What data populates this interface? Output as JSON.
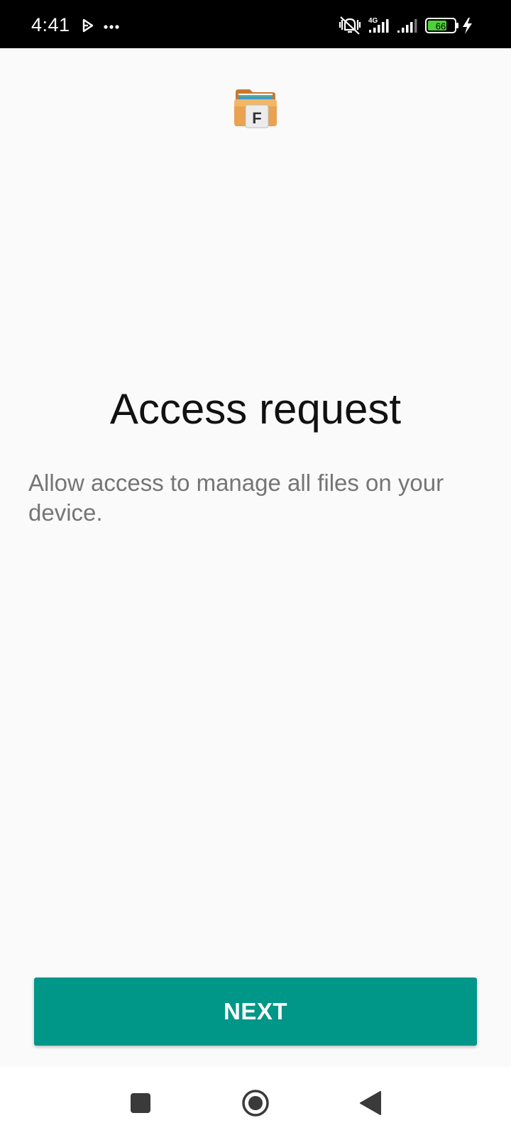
{
  "status_bar": {
    "time": "4:41",
    "network_label": "4G",
    "battery_level": "66",
    "icons": [
      "play-icon",
      "more-dots-icon",
      "vibrate-off-icon",
      "signal-4g-icon",
      "signal-icon",
      "battery-icon",
      "charging-icon"
    ]
  },
  "app": {
    "icon_name": "file-manager-folder-icon",
    "icon_letter": "F"
  },
  "main": {
    "title": "Access request",
    "description": "Allow access to manage all files on your device."
  },
  "actions": {
    "next_label": "NEXT"
  },
  "navigation": {
    "icons": [
      "recents-square-icon",
      "home-circle-icon",
      "back-triangle-icon"
    ]
  },
  "colors": {
    "accent": "#009688",
    "background": "#fafafa",
    "status_bar": "#000000",
    "battery_fill": "#4cd137"
  }
}
